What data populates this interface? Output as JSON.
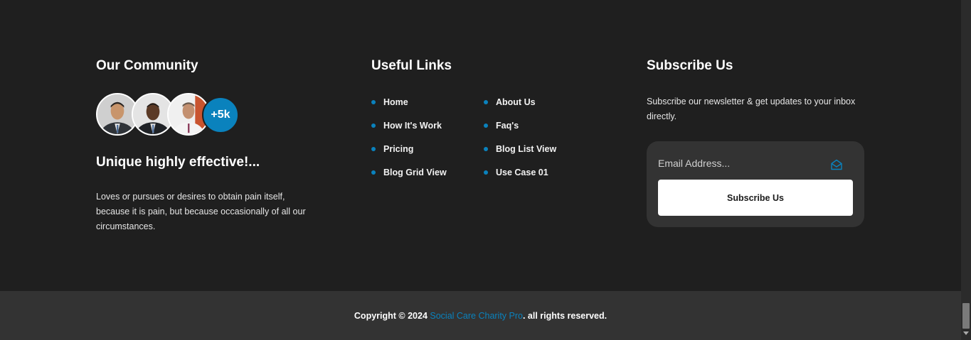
{
  "community": {
    "title": "Our Community",
    "avatar_count": "+5k",
    "tagline": "Unique highly effective!...",
    "description": "Loves or pursues or desires to obtain pain itself, because it is pain, but because occasionally of all our circumstances."
  },
  "useful_links": {
    "title": "Useful Links",
    "items": [
      {
        "label": "Home"
      },
      {
        "label": "About Us"
      },
      {
        "label": "How It's Work"
      },
      {
        "label": "Faq's"
      },
      {
        "label": "Pricing"
      },
      {
        "label": "Blog List View"
      },
      {
        "label": "Blog Grid View"
      },
      {
        "label": "Use Case 01"
      }
    ]
  },
  "subscribe": {
    "title": "Subscribe Us",
    "description": "Subscribe our newsletter & get updates to your inbox directly.",
    "email_placeholder": "Email Address...",
    "button_label": "Subscribe Us"
  },
  "footer": {
    "copyright_prefix": "Copyright © 2024 ",
    "brand": "Social Care Charity Pro",
    "copyright_suffix": ". all rights reserved."
  },
  "colors": {
    "background": "#1f1f1f",
    "bottom_bar": "#333333",
    "accent": "#0a82bd"
  },
  "icons": {
    "email": "envelope-open-icon",
    "bullet": "dot-icon"
  }
}
